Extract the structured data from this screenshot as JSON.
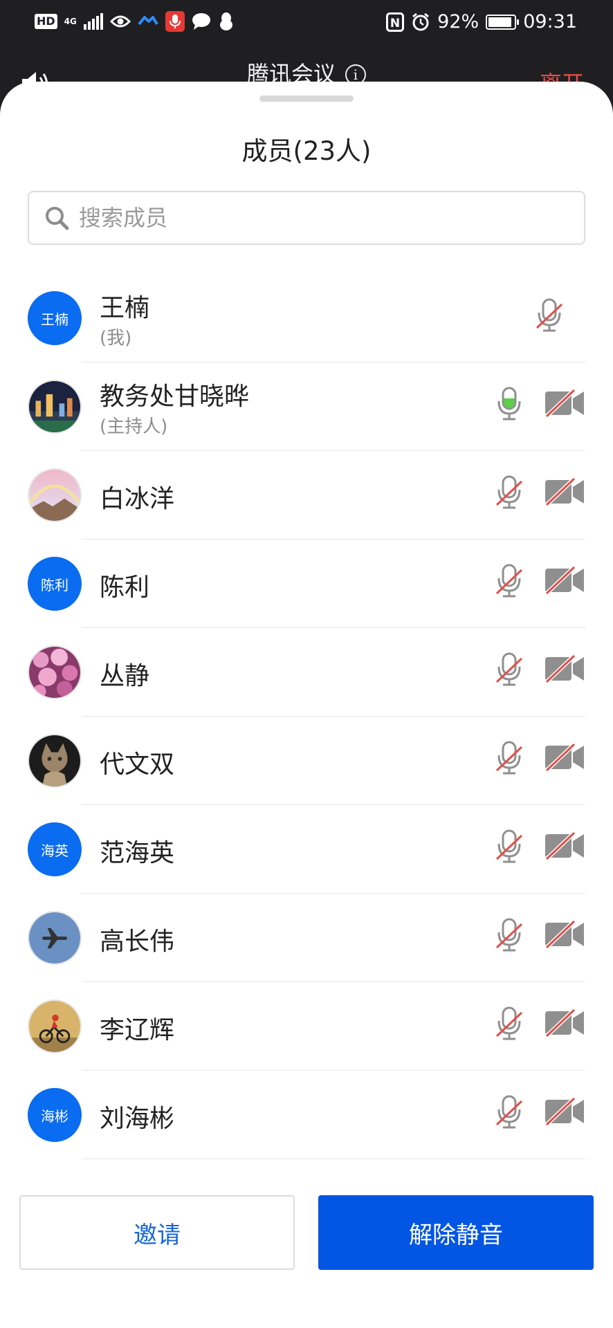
{
  "status_bar": {
    "hd": "HD",
    "network": "4G",
    "nfc": "N",
    "battery": "92%",
    "battery_level": 0.92,
    "time": "09:31"
  },
  "meeting": {
    "title": "腾讯会议",
    "info_glyph": "i",
    "leave_label": "离开"
  },
  "panel": {
    "title": "成员(23人)",
    "search_placeholder": "搜索成员"
  },
  "members": [
    {
      "name": "王楠",
      "subtitle": "(我)",
      "avatar_text": "王楠",
      "avatar": "initials",
      "mic": "muted",
      "video": null
    },
    {
      "name": "教务处甘晓晔",
      "subtitle": "(主持人)",
      "avatar_text": "",
      "avatar": "city-night-photo",
      "mic": "speaking",
      "video": "off"
    },
    {
      "name": "白冰洋",
      "subtitle": "",
      "avatar_text": "",
      "avatar": "rainbow-photo",
      "mic": "muted",
      "video": "off"
    },
    {
      "name": "陈利",
      "subtitle": "",
      "avatar_text": "陈利",
      "avatar": "initials",
      "mic": "muted",
      "video": "off"
    },
    {
      "name": "丛静",
      "subtitle": "",
      "avatar_text": "",
      "avatar": "pink-flowers-photo",
      "mic": "muted",
      "video": "off"
    },
    {
      "name": "代文双",
      "subtitle": "",
      "avatar_text": "",
      "avatar": "cat-photo",
      "mic": "muted",
      "video": "off"
    },
    {
      "name": "范海英",
      "subtitle": "",
      "avatar_text": "海英",
      "avatar": "initials",
      "mic": "muted",
      "video": "off"
    },
    {
      "name": "高长伟",
      "subtitle": "",
      "avatar_text": "",
      "avatar": "airplane-photo",
      "mic": "muted",
      "video": "off"
    },
    {
      "name": "李辽辉",
      "subtitle": "",
      "avatar_text": "",
      "avatar": "cyclist-photo",
      "mic": "muted",
      "video": "off"
    },
    {
      "name": "刘海彬",
      "subtitle": "",
      "avatar_text": "海彬",
      "avatar": "initials",
      "mic": "muted",
      "video": "off"
    }
  ],
  "buttons": {
    "invite": "邀请",
    "unmute_all": "解除静音"
  },
  "colors": {
    "accent": "#0256e3",
    "avatar_blue": "#0a6cf0",
    "mic_active": "#5ad046",
    "muted_slash": "#e0504a",
    "leave": "#f04a4a"
  }
}
